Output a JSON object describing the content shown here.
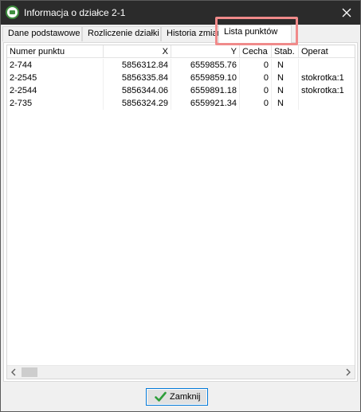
{
  "window": {
    "title": "Informacja o działce 2-1",
    "icon": "map-icon",
    "close_icon": "close-icon"
  },
  "tabs": [
    {
      "label": "Dane podstawowe",
      "active": false
    },
    {
      "label": "Rozliczenie działki",
      "active": false
    },
    {
      "label": "Historia zmian",
      "active": false
    },
    {
      "label": "Lista punktów",
      "active": true
    }
  ],
  "table": {
    "columns": [
      "Numer punktu",
      "X",
      "Y",
      "Cecha",
      "Stab.",
      "Operat"
    ],
    "rows": [
      {
        "numer": "2-744",
        "x": "5856312.84",
        "y": "6559855.76",
        "cecha": "0",
        "stab": "N",
        "operat": ""
      },
      {
        "numer": "2-2545",
        "x": "5856335.84",
        "y": "6559859.10",
        "cecha": "0",
        "stab": "N",
        "operat": "stokrotka:1"
      },
      {
        "numer": "2-2544",
        "x": "5856344.06",
        "y": "6559891.18",
        "cecha": "0",
        "stab": "N",
        "operat": "stokrotka:1"
      },
      {
        "numer": "2-735",
        "x": "5856324.29",
        "y": "6559921.34",
        "cecha": "0",
        "stab": "N",
        "operat": ""
      }
    ]
  },
  "footer": {
    "close_button_label": "Zamknij",
    "close_button_icon": "checkmark-icon"
  },
  "colors": {
    "titlebar": "#2b2b2b",
    "highlight": "#f08a8a",
    "checkmark": "#2e9e3a",
    "button_border": "#0078d7"
  }
}
